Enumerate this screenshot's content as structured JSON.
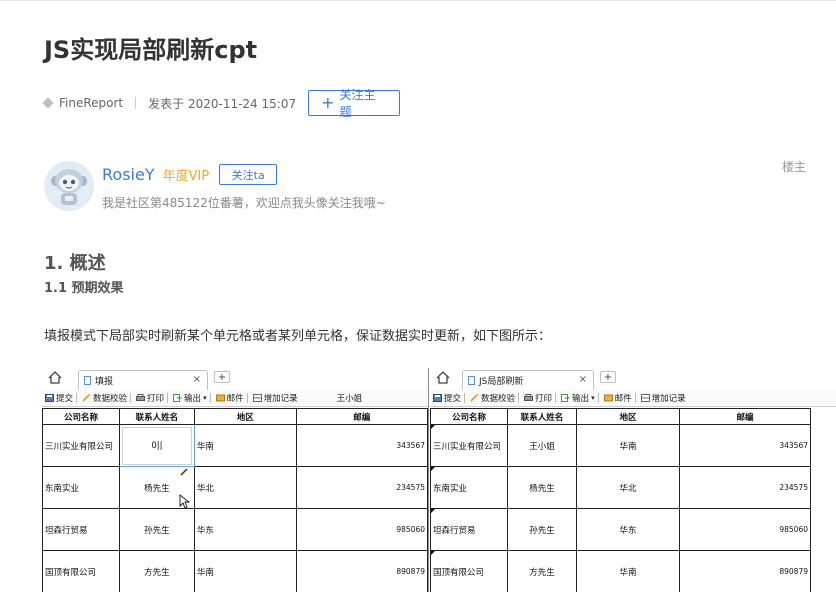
{
  "article": {
    "title": "JS实现局部刷新cpt",
    "tag": "FineReport",
    "published": "发表于 2020-11-24 15:07",
    "follow_topic_label": "关注主题"
  },
  "author": {
    "name": "RosieY",
    "vip": "年度VIP",
    "follow_label": "关注ta",
    "description": "我是社区第485122位番薯，欢迎点我头像关注我哦~",
    "floor_label": "楼主"
  },
  "content": {
    "h1": "1. 概述",
    "h2": "1.1 预期效果",
    "paragraph": "填报模式下局部实时刷新某个单元格或者某列单元格，保证数据实时更新，如下图所示："
  },
  "left_pane": {
    "tab_label": "填报",
    "tab_close": "×",
    "tab_add": "+",
    "toolbar": [
      "提交",
      "数据校验",
      "打印",
      "输出",
      "邮件",
      "增加记录"
    ],
    "toolbar_dropdown": "▾",
    "toolbar_extra": "王小姐",
    "headers": [
      "公司名称",
      "联系人姓名",
      "地区",
      "邮编"
    ],
    "rows": [
      [
        "三川实业有限公司",
        "0||",
        "华南",
        "343567"
      ],
      [
        "东南实业",
        "杨先生",
        "华北",
        "234575"
      ],
      [
        "坦森行贸易",
        "孙先生",
        "华东",
        "985060"
      ],
      [
        "国顶有限公司",
        "方先生",
        "华南",
        "890879"
      ]
    ]
  },
  "right_pane": {
    "tab_label": "JS局部刷新",
    "tab_close": "×",
    "tab_add": "+",
    "toolbar": [
      "提交",
      "数据校验",
      "打印",
      "输出",
      "邮件",
      "增加记录"
    ],
    "toolbar_dropdown": "▾",
    "headers": [
      "公司名称",
      "联系人姓名",
      "地区",
      "邮编"
    ],
    "rows": [
      [
        "三川实业有限公司",
        "王小姐",
        "华南",
        "343567"
      ],
      [
        "东南实业",
        "杨先生",
        "华北",
        "234575"
      ],
      [
        "坦森行贸易",
        "孙先生",
        "华东",
        "985060"
      ],
      [
        "国顶有限公司",
        "方先生",
        "华南",
        "890879"
      ]
    ]
  },
  "colors": {
    "link": "#3a7bd5",
    "vip": "#f5a623",
    "text": "#333333",
    "muted": "#888888"
  },
  "icons": {
    "tag": "tag-icon",
    "plus": "plus-icon",
    "avatar": "robot-avatar",
    "home": "home-icon",
    "cursor": "mouse-cursor-icon"
  }
}
